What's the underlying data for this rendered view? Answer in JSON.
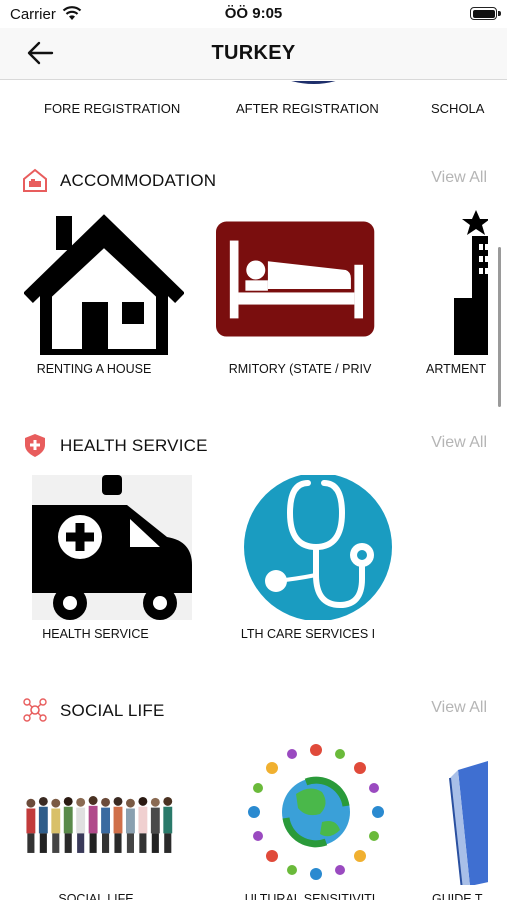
{
  "status": {
    "carrier": "Carrier",
    "time": "ÖÖ 9:05"
  },
  "nav": {
    "title": "TURKEY"
  },
  "top_strip": {
    "items": [
      "FORE REGISTRATION",
      "AFTER REGISTRATION",
      "SCHOLA"
    ]
  },
  "sections": [
    {
      "title": "ACCOMMODATION",
      "view_all": "View All",
      "icon": "house-icon",
      "accent": "#e85d5d",
      "cards": [
        {
          "label": "RENTING A HOUSE",
          "image": "house-image"
        },
        {
          "label": "RMITORY (STATE / PRIV",
          "image": "bed-image"
        },
        {
          "label": "ARTMENT",
          "image": "building-image"
        }
      ]
    },
    {
      "title": "HEALTH SERVICE",
      "view_all": "View All",
      "icon": "shield-plus-icon",
      "accent": "#e85d5d",
      "cards": [
        {
          "label": "HEALTH SERVICE",
          "image": "ambulance-image"
        },
        {
          "label": "LTH CARE SERVICES I",
          "image": "stethoscope-image"
        }
      ]
    },
    {
      "title": "SOCIAL LIFE",
      "view_all": "View All",
      "icon": "people-network-icon",
      "accent": "#e85d5d",
      "cards": [
        {
          "label": "SOCIAL LIFE",
          "image": "crowd-image"
        },
        {
          "label": "ULTURAL SENSITIVITI",
          "image": "globe-people-image"
        },
        {
          "label": "GUIDE T",
          "image": "book-image"
        }
      ]
    }
  ],
  "colors": {
    "accent": "#e85d5d",
    "bed_bg": "#7a0e0e",
    "stethoscope_bg": "#1a9cc1",
    "view_all": "#b5b5b5"
  }
}
